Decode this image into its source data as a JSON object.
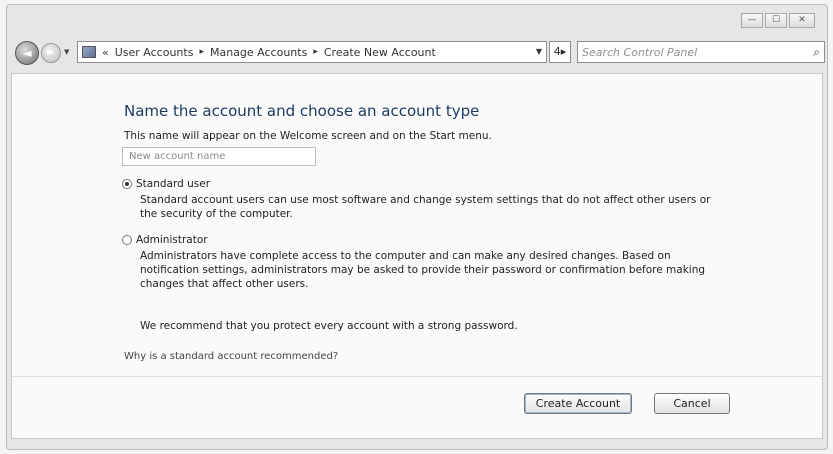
{
  "caption": {
    "minimize_glyph": "—",
    "maximize_glyph": "☐",
    "close_glyph": "✕"
  },
  "nav": {
    "back_glyph": "◄",
    "forward_glyph": "►",
    "history_glyph": "▼",
    "breadcrumb_prefix": "«",
    "breadcrumbs": [
      "User Accounts",
      "Manage Accounts",
      "Create New Account"
    ],
    "crumb_separator": "▸",
    "address_dropdown_glyph": "▼",
    "refresh_glyph": "4▸",
    "search_placeholder": "Search Control Panel",
    "search_glyph": "⌕"
  },
  "main": {
    "title": "Name the account and choose an account type",
    "description": "This name will appear on the Welcome screen and on the Start menu.",
    "name_input_value": "New account name",
    "standard": {
      "label": "Standard user",
      "checked": true,
      "description": "Standard account users can use most software and change system settings that do not affect other users or the security of the computer."
    },
    "admin": {
      "label": "Administrator",
      "checked": false,
      "description": "Administrators have complete access to the computer and can make any desired changes. Based on notification settings, administrators may be asked to provide their password or confirmation before making changes that affect other users."
    },
    "recommendation": "We recommend that you protect every account with a strong password.",
    "why_link": "Why is a standard account recommended?"
  },
  "buttons": {
    "create": "Create Account",
    "cancel": "Cancel"
  },
  "colors": {
    "title": "#1e3b63",
    "window_bg": "#e6e6e6",
    "content_bg": "#fafafa"
  }
}
